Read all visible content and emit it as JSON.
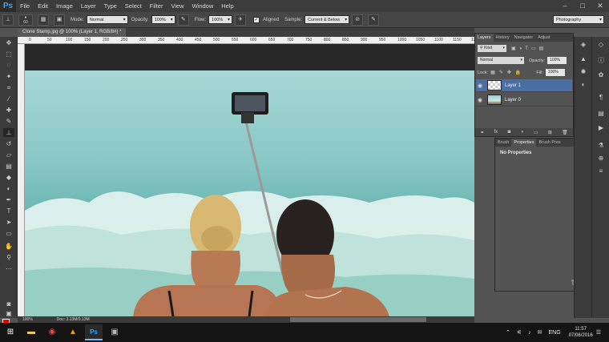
{
  "app": {
    "logo": "Ps"
  },
  "menu": [
    "File",
    "Edit",
    "Image",
    "Layer",
    "Type",
    "Select",
    "Filter",
    "View",
    "Window",
    "Help"
  ],
  "window_controls": {
    "minimize": "–",
    "maximize": "□",
    "close": "✕"
  },
  "options_bar": {
    "brush_size": "60",
    "mode_label": "Mode:",
    "mode_value": "Normal",
    "opacity_label": "Opacity:",
    "opacity_value": "100%",
    "flow_label": "Flow:",
    "flow_value": "100%",
    "aligned_label": "Aligned",
    "aligned_checked": true,
    "sample_label": "Sample:",
    "sample_value": "Current & Below",
    "workspace": "Photography"
  },
  "document": {
    "tab_title": "Clone Stamp.jpg @ 100% (Layer 1, RGB/8#) *",
    "zoom": "100%",
    "doc_info": "Doc: 3.13M/3.13M",
    "ruler_ticks": [
      "0",
      "50",
      "100",
      "150",
      "200",
      "250",
      "300",
      "350",
      "400",
      "450",
      "500",
      "550",
      "600",
      "650",
      "700",
      "750",
      "800",
      "850",
      "900",
      "950",
      "1000",
      "1050",
      "1100",
      "1150",
      "1200"
    ]
  },
  "layers_panel": {
    "tabs": [
      "Layers",
      "History",
      "Navigator",
      "Adjust"
    ],
    "active_tab": "Layers",
    "kind_label": "Kind",
    "blend_mode": "Normal",
    "opacity_label": "Opacity:",
    "opacity_value": "100%",
    "lock_label": "Lock:",
    "fill_label": "Fill:",
    "fill_value": "100%",
    "layers": [
      {
        "name": "Layer 1",
        "selected": true,
        "thumb": "transparent"
      },
      {
        "name": "Layer 0",
        "selected": false,
        "thumb": "photo"
      }
    ]
  },
  "properties_panel": {
    "tabs": [
      "Brush",
      "Properties",
      "Brush Pres"
    ],
    "active_tab": "Properties",
    "content": "No Properties"
  },
  "colors": {
    "foreground": "#e60000",
    "background": "#ffffff"
  },
  "taskbar": {
    "language": "ENG",
    "time": "11:57",
    "date": "07/06/2016"
  }
}
